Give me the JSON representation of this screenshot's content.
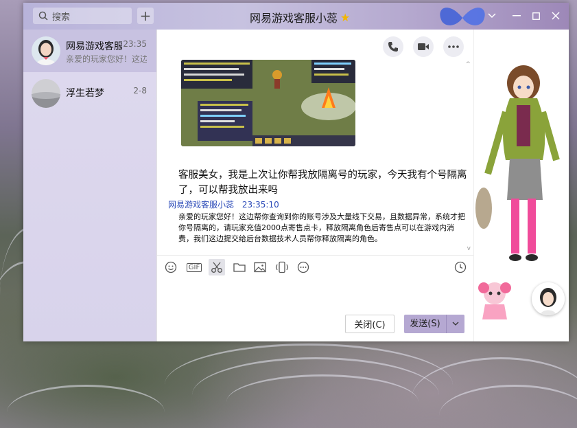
{
  "window": {
    "title": "网易游戏客服小蕊",
    "title_star": "★"
  },
  "search": {
    "placeholder": "搜索"
  },
  "add_button": {
    "label": "+"
  },
  "contacts": [
    {
      "name": "网易游戏客服小蕊",
      "time": "23:35",
      "preview": "亲爱的玩家您好！这边帮你查询到你的账号",
      "active": true
    },
    {
      "name": "浮生若梦",
      "time": "2-8",
      "preview": "",
      "active": false
    }
  ],
  "chat": {
    "message_user": "客服美女，我是上次让你帮我放隔离号的玩家，今天我有个号隔离了，可以帮我放出来吗",
    "reply_sender": "网易游戏客服小蕊",
    "reply_time": "23:35:10",
    "reply_text": "亲爱的玩家您好！这边帮你查询到你的账号涉及大量线下交易，且数据异常，系统才把你号隔离的，请玩家充值2000点寄售点卡，释放隔离角色后寄售点可以在游戏内消费，我们这边提交给后台数据技术人员帮你释放隔离的角色。"
  },
  "toolbar": {
    "gif_label": "GIF"
  },
  "buttons": {
    "close": "关闭(C)",
    "send": "发送(S)"
  },
  "colors": {
    "title_bar": "#c7c2e0",
    "sidebar": "#d8d3eb",
    "active_contact": "#c8c2e1",
    "send_button": "#b5a8d2",
    "sender_name": "#2b4ab8"
  }
}
